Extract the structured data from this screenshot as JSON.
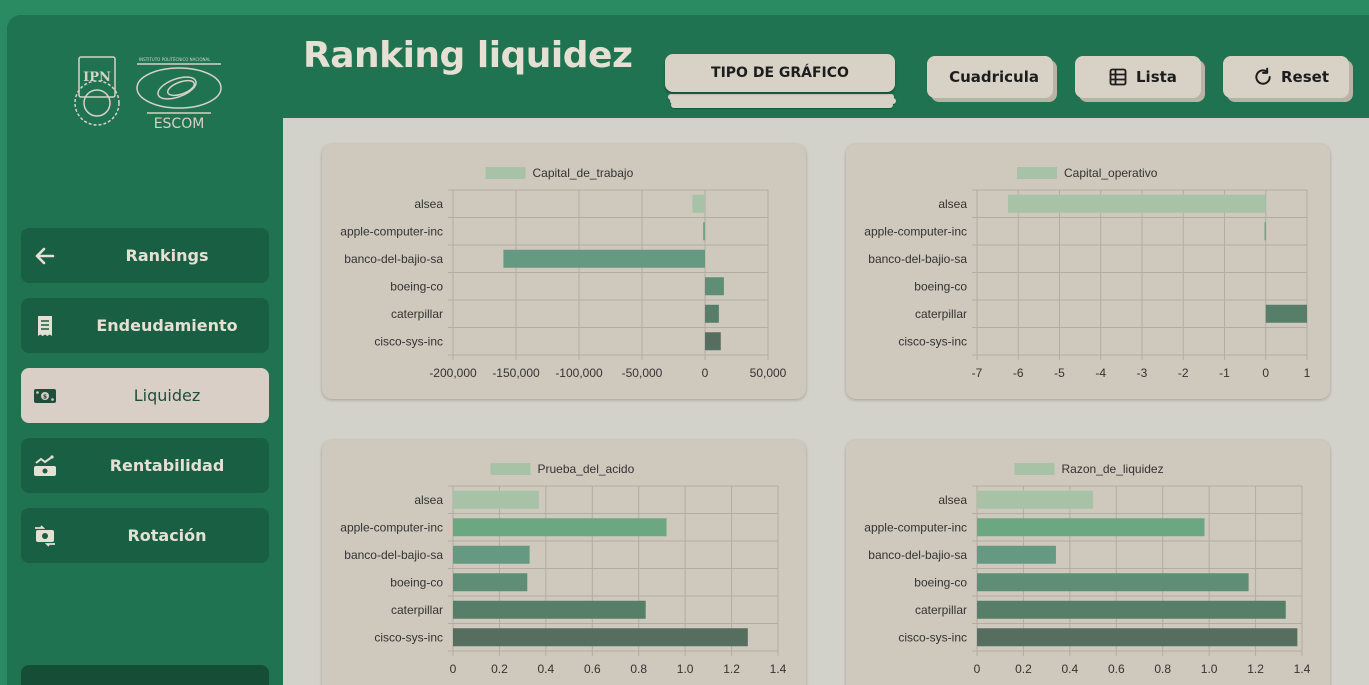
{
  "header": {
    "title": "Ranking liquidez",
    "chart_type_label": "TIPO DE GRÁFICO",
    "buttons": {
      "grid": "Cuadricula",
      "list": "Lista",
      "reset": "Reset"
    }
  },
  "logo": {
    "institution_text": "INSTITUTO POLITÉCNICO NACIONAL",
    "ipn": "IPN",
    "escom": "ESCOM"
  },
  "sidebar": {
    "items": [
      {
        "label": "Rankings",
        "icon": "arrow-left-icon",
        "active": false
      },
      {
        "label": "Endeudamiento",
        "icon": "receipt-icon",
        "active": false
      },
      {
        "label": "Liquidez",
        "icon": "cash-icon",
        "active": true
      },
      {
        "label": "Rentabilidad",
        "icon": "money-chart-icon",
        "active": false
      },
      {
        "label": "Rotación",
        "icon": "exchange-cash-icon",
        "active": false
      }
    ]
  },
  "colors": {
    "bars": [
      "#a8c2a8",
      "#6ba882",
      "#669981",
      "#5e8f76",
      "#567e69",
      "#566e5f"
    ]
  },
  "chart_data": [
    {
      "type": "bar",
      "orientation": "horizontal",
      "categories": [
        "alsea",
        "apple-computer-inc",
        "banco-del-bajio-sa",
        "boeing-co",
        "caterpillar",
        "cisco-sys-inc"
      ],
      "series": [
        {
          "name": "Capital_de_trabajo",
          "values": [
            -10000,
            -1500,
            -160000,
            15000,
            11000,
            12500
          ]
        }
      ],
      "xlim": [
        -200000,
        50000
      ],
      "xticks": [
        -200000,
        -150000,
        -100000,
        -50000,
        0,
        50000
      ],
      "xtick_labels": [
        "-200,000",
        "-150,000",
        "-100,000",
        "-50,000",
        "0",
        "50,000"
      ],
      "grid": true,
      "legend": "top"
    },
    {
      "type": "bar",
      "orientation": "horizontal",
      "categories": [
        "alsea",
        "apple-computer-inc",
        "banco-del-bajio-sa",
        "boeing-co",
        "caterpillar",
        "cisco-sys-inc"
      ],
      "series": [
        {
          "name": "Capital_operativo",
          "values": [
            -6.25,
            -0.03,
            0,
            0,
            1.0,
            0
          ]
        }
      ],
      "xlim": [
        -7,
        1
      ],
      "xticks": [
        -7,
        -6,
        -5,
        -4,
        -3,
        -2,
        -1,
        0,
        1
      ],
      "xtick_labels": [
        "-7",
        "-6",
        "-5",
        "-4",
        "-3",
        "-2",
        "-1",
        "0",
        "1"
      ],
      "grid": true,
      "legend": "top"
    },
    {
      "type": "bar",
      "orientation": "horizontal",
      "categories": [
        "alsea",
        "apple-computer-inc",
        "banco-del-bajio-sa",
        "boeing-co",
        "caterpillar",
        "cisco-sys-inc"
      ],
      "series": [
        {
          "name": "Prueba_del_acido",
          "values": [
            0.37,
            0.92,
            0.33,
            0.32,
            0.83,
            1.27
          ]
        }
      ],
      "xlim": [
        0,
        1.4
      ],
      "xticks": [
        0,
        0.2,
        0.4,
        0.6,
        0.8,
        1.0,
        1.2,
        1.4
      ],
      "xtick_labels": [
        "0",
        "0.2",
        "0.4",
        "0.6",
        "0.8",
        "1.0",
        "1.2",
        "1.4"
      ],
      "grid": true,
      "legend": "top"
    },
    {
      "type": "bar",
      "orientation": "horizontal",
      "categories": [
        "alsea",
        "apple-computer-inc",
        "banco-del-bajio-sa",
        "boeing-co",
        "caterpillar",
        "cisco-sys-inc"
      ],
      "series": [
        {
          "name": "Razon_de_liquidez",
          "values": [
            0.5,
            0.98,
            0.34,
            1.17,
            1.33,
            1.38
          ]
        }
      ],
      "xlim": [
        0,
        1.4
      ],
      "xticks": [
        0,
        0.2,
        0.4,
        0.6,
        0.8,
        1.0,
        1.2,
        1.4
      ],
      "xtick_labels": [
        "0",
        "0.2",
        "0.4",
        "0.6",
        "0.8",
        "1.0",
        "1.2",
        "1.4"
      ],
      "grid": true,
      "legend": "top"
    }
  ]
}
